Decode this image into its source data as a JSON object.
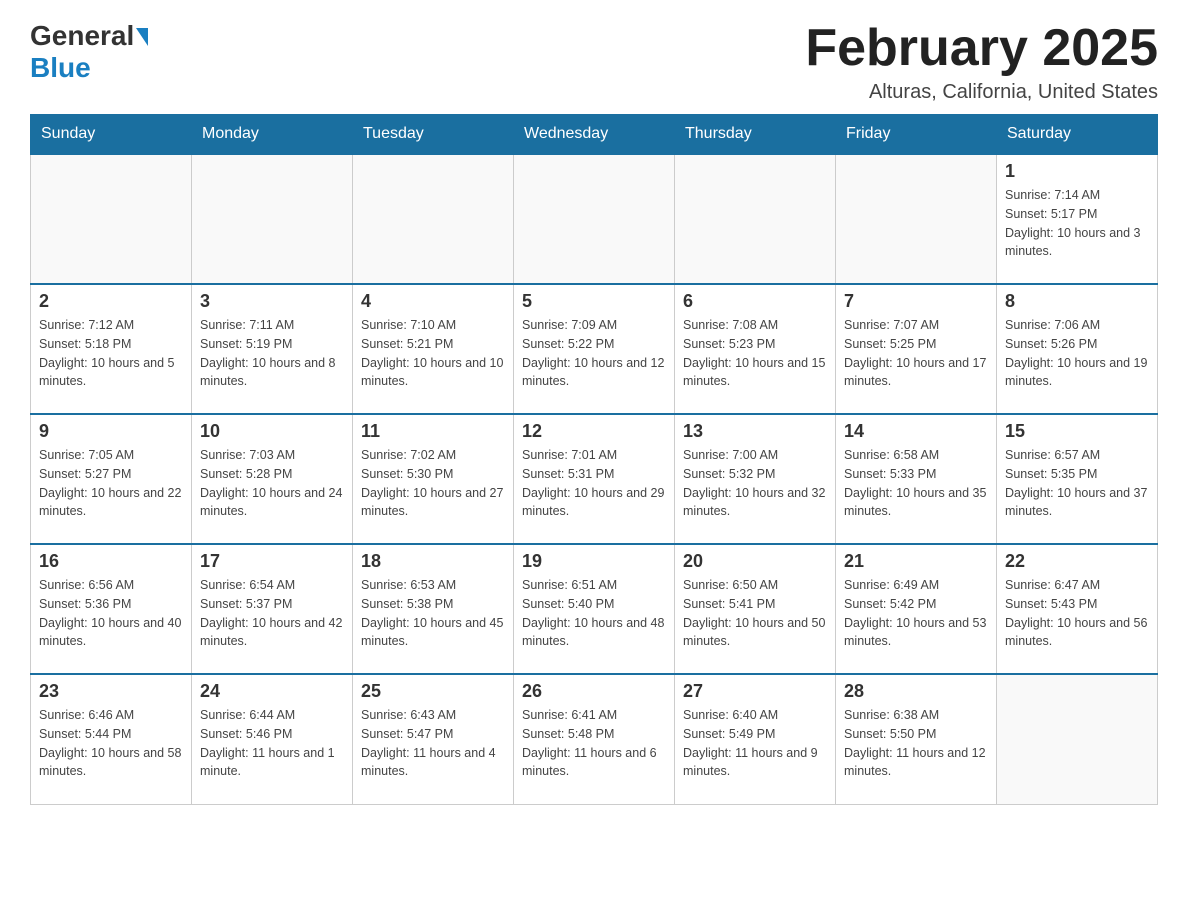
{
  "header": {
    "logo_general": "General",
    "logo_blue": "Blue",
    "month_title": "February 2025",
    "location": "Alturas, California, United States"
  },
  "days_of_week": [
    "Sunday",
    "Monday",
    "Tuesday",
    "Wednesday",
    "Thursday",
    "Friday",
    "Saturday"
  ],
  "weeks": [
    [
      {
        "day": "",
        "info": ""
      },
      {
        "day": "",
        "info": ""
      },
      {
        "day": "",
        "info": ""
      },
      {
        "day": "",
        "info": ""
      },
      {
        "day": "",
        "info": ""
      },
      {
        "day": "",
        "info": ""
      },
      {
        "day": "1",
        "info": "Sunrise: 7:14 AM\nSunset: 5:17 PM\nDaylight: 10 hours and 3 minutes."
      }
    ],
    [
      {
        "day": "2",
        "info": "Sunrise: 7:12 AM\nSunset: 5:18 PM\nDaylight: 10 hours and 5 minutes."
      },
      {
        "day": "3",
        "info": "Sunrise: 7:11 AM\nSunset: 5:19 PM\nDaylight: 10 hours and 8 minutes."
      },
      {
        "day": "4",
        "info": "Sunrise: 7:10 AM\nSunset: 5:21 PM\nDaylight: 10 hours and 10 minutes."
      },
      {
        "day": "5",
        "info": "Sunrise: 7:09 AM\nSunset: 5:22 PM\nDaylight: 10 hours and 12 minutes."
      },
      {
        "day": "6",
        "info": "Sunrise: 7:08 AM\nSunset: 5:23 PM\nDaylight: 10 hours and 15 minutes."
      },
      {
        "day": "7",
        "info": "Sunrise: 7:07 AM\nSunset: 5:25 PM\nDaylight: 10 hours and 17 minutes."
      },
      {
        "day": "8",
        "info": "Sunrise: 7:06 AM\nSunset: 5:26 PM\nDaylight: 10 hours and 19 minutes."
      }
    ],
    [
      {
        "day": "9",
        "info": "Sunrise: 7:05 AM\nSunset: 5:27 PM\nDaylight: 10 hours and 22 minutes."
      },
      {
        "day": "10",
        "info": "Sunrise: 7:03 AM\nSunset: 5:28 PM\nDaylight: 10 hours and 24 minutes."
      },
      {
        "day": "11",
        "info": "Sunrise: 7:02 AM\nSunset: 5:30 PM\nDaylight: 10 hours and 27 minutes."
      },
      {
        "day": "12",
        "info": "Sunrise: 7:01 AM\nSunset: 5:31 PM\nDaylight: 10 hours and 29 minutes."
      },
      {
        "day": "13",
        "info": "Sunrise: 7:00 AM\nSunset: 5:32 PM\nDaylight: 10 hours and 32 minutes."
      },
      {
        "day": "14",
        "info": "Sunrise: 6:58 AM\nSunset: 5:33 PM\nDaylight: 10 hours and 35 minutes."
      },
      {
        "day": "15",
        "info": "Sunrise: 6:57 AM\nSunset: 5:35 PM\nDaylight: 10 hours and 37 minutes."
      }
    ],
    [
      {
        "day": "16",
        "info": "Sunrise: 6:56 AM\nSunset: 5:36 PM\nDaylight: 10 hours and 40 minutes."
      },
      {
        "day": "17",
        "info": "Sunrise: 6:54 AM\nSunset: 5:37 PM\nDaylight: 10 hours and 42 minutes."
      },
      {
        "day": "18",
        "info": "Sunrise: 6:53 AM\nSunset: 5:38 PM\nDaylight: 10 hours and 45 minutes."
      },
      {
        "day": "19",
        "info": "Sunrise: 6:51 AM\nSunset: 5:40 PM\nDaylight: 10 hours and 48 minutes."
      },
      {
        "day": "20",
        "info": "Sunrise: 6:50 AM\nSunset: 5:41 PM\nDaylight: 10 hours and 50 minutes."
      },
      {
        "day": "21",
        "info": "Sunrise: 6:49 AM\nSunset: 5:42 PM\nDaylight: 10 hours and 53 minutes."
      },
      {
        "day": "22",
        "info": "Sunrise: 6:47 AM\nSunset: 5:43 PM\nDaylight: 10 hours and 56 minutes."
      }
    ],
    [
      {
        "day": "23",
        "info": "Sunrise: 6:46 AM\nSunset: 5:44 PM\nDaylight: 10 hours and 58 minutes."
      },
      {
        "day": "24",
        "info": "Sunrise: 6:44 AM\nSunset: 5:46 PM\nDaylight: 11 hours and 1 minute."
      },
      {
        "day": "25",
        "info": "Sunrise: 6:43 AM\nSunset: 5:47 PM\nDaylight: 11 hours and 4 minutes."
      },
      {
        "day": "26",
        "info": "Sunrise: 6:41 AM\nSunset: 5:48 PM\nDaylight: 11 hours and 6 minutes."
      },
      {
        "day": "27",
        "info": "Sunrise: 6:40 AM\nSunset: 5:49 PM\nDaylight: 11 hours and 9 minutes."
      },
      {
        "day": "28",
        "info": "Sunrise: 6:38 AM\nSunset: 5:50 PM\nDaylight: 11 hours and 12 minutes."
      },
      {
        "day": "",
        "info": ""
      }
    ]
  ]
}
